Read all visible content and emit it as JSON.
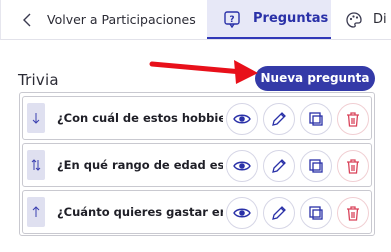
{
  "nav": {
    "back_label": "Volver a Participaciones",
    "active_tab_label": "Preguntas",
    "next_tab_label": "Di"
  },
  "section": {
    "title": "Trivia",
    "new_button_label": "Nueva pregunta"
  },
  "questions": [
    {
      "text": "¿Con cuál de estos hobbies te identificas más?",
      "handle": "arrow-down-icon"
    },
    {
      "text": "¿En qué rango de edad estás?",
      "handle": "arrow-up-down-icon"
    },
    {
      "text": "¿Cuánto quieres gastar en tu regalo?",
      "handle": "arrow-up-icon"
    }
  ],
  "colors": {
    "brand": "#343aa8",
    "active_tab_bg": "#e7e8f7",
    "arrow": "#e8101a",
    "delete": "#d9435a",
    "icon": "#2a31a8"
  }
}
